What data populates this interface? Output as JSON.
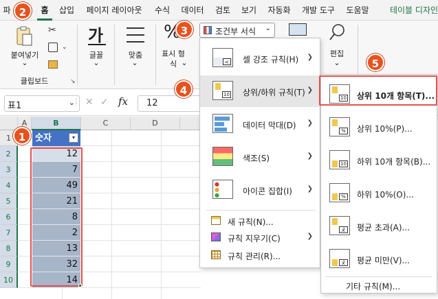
{
  "menubar": {
    "tabs": [
      "파",
      "홈",
      "삽입",
      "페이지 레이아웃",
      "수식",
      "데이터",
      "검토",
      "보기",
      "자동화",
      "개발 도구",
      "도움말",
      "테이블 디자인"
    ]
  },
  "ribbon": {
    "paste_label": "붙여넣기",
    "clipboard_group": "클립보드",
    "font_label": "글꼴",
    "align_label": "맞춤",
    "number_label_1": "표시 형",
    "number_label_2": "식",
    "cf_button": "조건부 서식",
    "edit_label": "편집",
    "font_glyph": "가",
    "percent_glyph": "%"
  },
  "formula_bar": {
    "name_box": "표1",
    "fx": "fx",
    "value": "12"
  },
  "sheet": {
    "columns": [
      "A",
      "B",
      "C",
      "D"
    ],
    "rows": [
      "1",
      "2",
      "3",
      "4",
      "5",
      "6",
      "7",
      "8",
      "9",
      "10"
    ],
    "header_cell": "숫자",
    "values": [
      "12",
      "7",
      "49",
      "21",
      "8",
      "2",
      "13",
      "32",
      "14"
    ]
  },
  "cf_menu": {
    "items": [
      "셀 강조 규칙(H)",
      "상위/하위 규칙(T)",
      "데이터 막대(D)",
      "색조(S)",
      "아이콘 집합(I)"
    ],
    "small_items": [
      "새 규칙(N)...",
      "규칙 지우기(C)",
      "규칙 관리(R)..."
    ]
  },
  "submenu": {
    "items": [
      "상위 10개 항목(T)...",
      "상위 10%(P)...",
      "하위 10개 항목(B)...",
      "하위 10%(O)...",
      "평균 초과(A)...",
      "평균 미만(V)..."
    ],
    "footer": "기타 규칙(M)...",
    "icon_labels": [
      "10",
      "%",
      "10",
      "%",
      "x̄",
      "x̄"
    ]
  },
  "badges": [
    "1",
    "2",
    "3",
    "4",
    "5"
  ],
  "colors": {
    "accent": "#217346",
    "badge": "#e8521e",
    "selection": "#a7b5c9",
    "header_fill": "#4472c4"
  }
}
